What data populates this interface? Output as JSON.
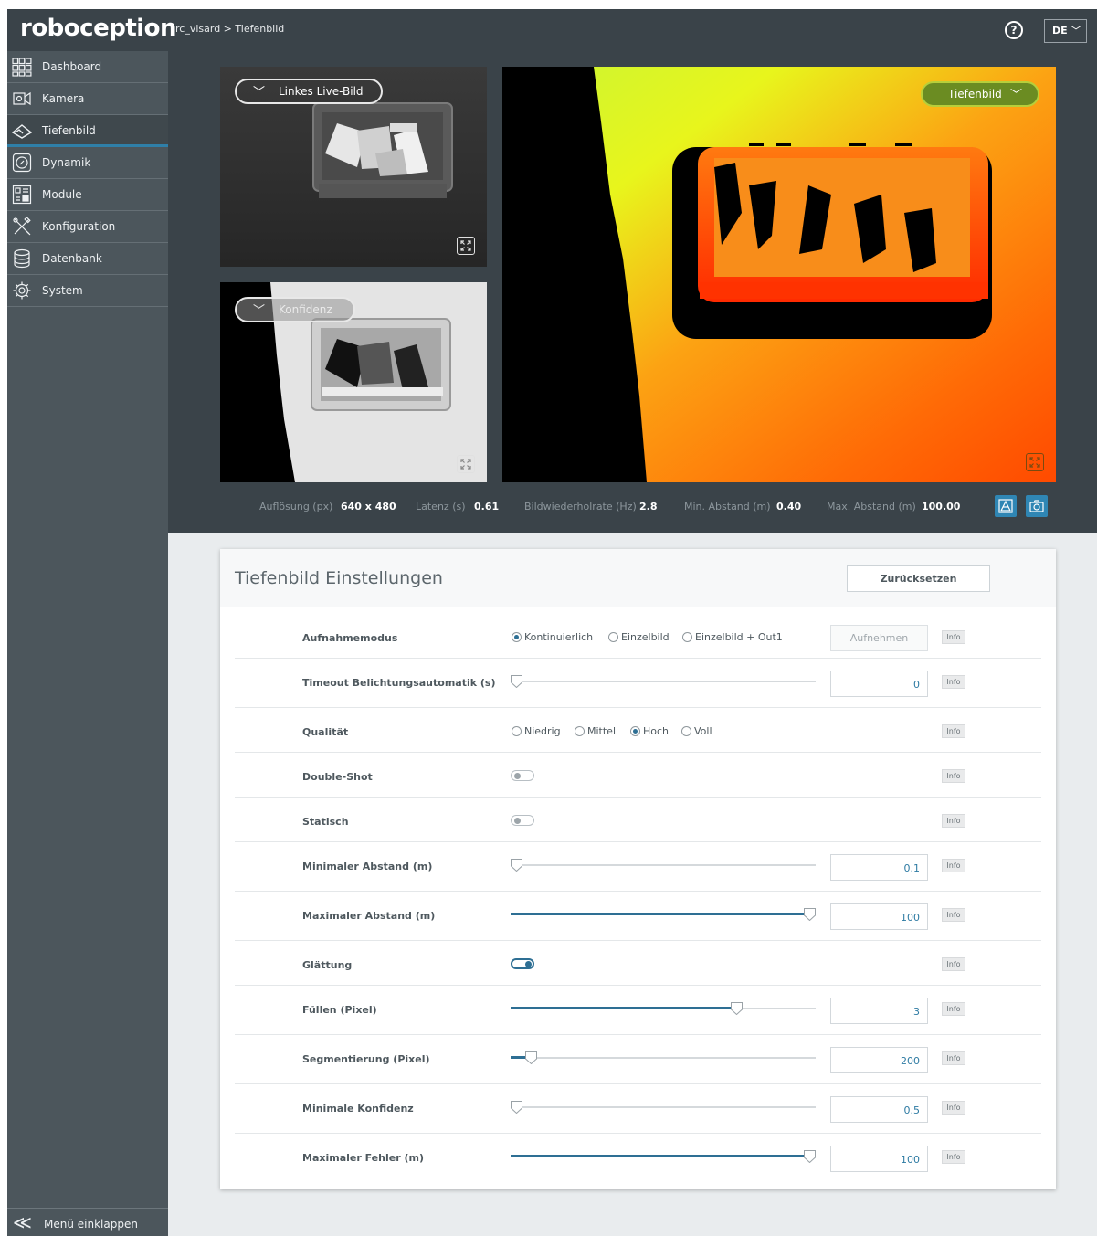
{
  "app": {
    "logo": "roboception"
  },
  "breadcrumb": "rc_visard > Tiefenbild",
  "header": {
    "help_label": "?",
    "language": "DE"
  },
  "sidebar": {
    "items": [
      {
        "label": "Dashboard",
        "icon": "dashboard-grid-icon"
      },
      {
        "label": "Kamera",
        "icon": "camera-icon"
      },
      {
        "label": "Tiefenbild",
        "icon": "depth-image-icon",
        "active": true
      },
      {
        "label": "Dynamik",
        "icon": "dynamics-icon"
      },
      {
        "label": "Module",
        "icon": "modules-icon"
      },
      {
        "label": "Konfiguration",
        "icon": "tools-icon"
      },
      {
        "label": "Datenbank",
        "icon": "database-icon"
      },
      {
        "label": "System",
        "icon": "gear-icon"
      }
    ],
    "collapse_label": "Menü einklappen"
  },
  "images": {
    "left_top_dropdown": "Linkes Live-Bild",
    "left_bottom_dropdown": "Konfidenz",
    "main_dropdown": "Tiefenbild"
  },
  "stats": [
    {
      "label": "Auflösung (px)",
      "value": "640 x 480"
    },
    {
      "label": "Latenz (s)",
      "value": "0.61"
    },
    {
      "label": "Bildwiederholrate (Hz)",
      "value": "2.8"
    },
    {
      "label": "Min. Abstand (m)",
      "value": "0.40"
    },
    {
      "label": "Max. Abstand (m)",
      "value": "100.00"
    }
  ],
  "settings": {
    "title": "Tiefenbild Einstellungen",
    "reset_label": "Zurücksetzen",
    "info_label": "Info",
    "capture_label": "Aufnehmen",
    "rows": {
      "mode": {
        "label": "Aufnahmemodus",
        "options": [
          "Kontinuierlich",
          "Einzelbild",
          "Einzelbild + Out1"
        ],
        "selected": "Kontinuierlich"
      },
      "timeout": {
        "label": "Timeout Belichtungsautomatik (s)",
        "value": "0",
        "fraction": 0.0
      },
      "quality": {
        "label": "Qualität",
        "options": [
          "Niedrig",
          "Mittel",
          "Hoch",
          "Voll"
        ],
        "selected": "Hoch"
      },
      "double_shot": {
        "label": "Double-Shot",
        "on": false
      },
      "static": {
        "label": "Statisch",
        "on": false
      },
      "min_dist": {
        "label": "Minimaler Abstand (m)",
        "value": "0.1",
        "fraction": 0.0
      },
      "max_dist": {
        "label": "Maximaler Abstand (m)",
        "value": "100",
        "fraction": 1.0
      },
      "smoothing": {
        "label": "Glättung",
        "on": true
      },
      "fill": {
        "label": "Füllen (Pixel)",
        "value": "3",
        "fraction": 0.75
      },
      "segmentation": {
        "label": "Segmentierung (Pixel)",
        "value": "200",
        "fraction": 0.05
      },
      "min_conf": {
        "label": "Minimale Konfidenz",
        "value": "0.5",
        "fraction": 0.0
      },
      "max_err": {
        "label": "Maximaler Fehler (m)",
        "value": "100",
        "fraction": 1.0
      }
    }
  },
  "colors": {
    "accent": "#2e6f94",
    "topbar": "#3a4349",
    "sidebar": "#4c565c"
  }
}
